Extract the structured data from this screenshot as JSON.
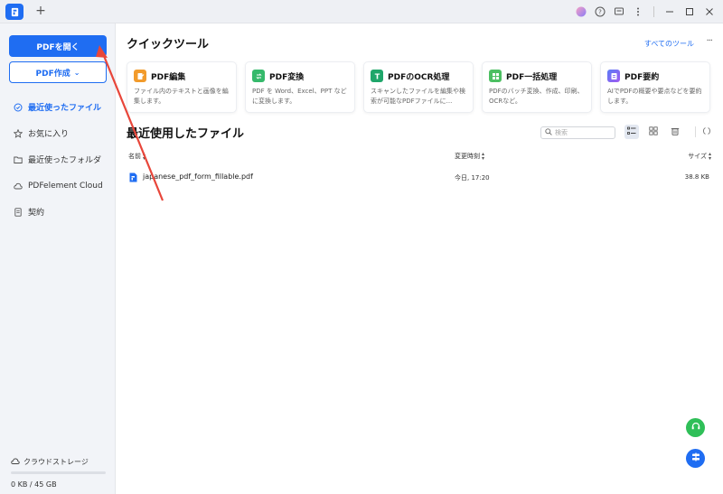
{
  "titlebar": {
    "icons": [
      "app-logo-icon",
      "plus-icon",
      "avatar-icon",
      "help-icon",
      "message-icon",
      "more-vertical-icon",
      "minimize-icon",
      "maximize-icon",
      "close-icon"
    ]
  },
  "sidebar": {
    "open_label": "PDFを開く",
    "create_label": "PDF作成",
    "items": [
      {
        "label": "最近使ったファイル",
        "icon": "clock-icon",
        "active": true
      },
      {
        "label": "お気に入り",
        "icon": "star-icon",
        "active": false
      },
      {
        "label": "最近使ったフォルダ",
        "icon": "folder-icon",
        "active": false
      },
      {
        "label": "PDFelement Cloud",
        "icon": "cloud-icon",
        "active": false
      },
      {
        "label": "契約",
        "icon": "document-icon",
        "active": false
      }
    ],
    "storage": {
      "label": "クラウドストレージ",
      "size": "0 KB / 45 GB",
      "fill_fraction": 0.0
    }
  },
  "quick_tools": {
    "title": "クイックツール",
    "all_link": "すべてのツール",
    "more": "···",
    "cards": [
      {
        "title": "PDF編集",
        "desc": "ファイル内のテキストと画像を編集します。",
        "icon": "edit-icon",
        "color": "#f29b2c"
      },
      {
        "title": "PDF変換",
        "desc": "PDF を Word、Excel、PPT などに変換します。",
        "icon": "convert-icon",
        "color": "#35b96b"
      },
      {
        "title": "PDFのOCR処理",
        "desc": "スキャンしたファイルを編集や検索が可能なPDFファイルに...",
        "icon": "ocr-icon",
        "color": "#1fa66a"
      },
      {
        "title": "PDF一括処理",
        "desc": "PDFのバッチ変換、作成、印刷、OCRなど。",
        "icon": "batch-icon",
        "color": "#4cbf62"
      },
      {
        "title": "PDF要約",
        "desc": "AIでPDFの概要や要点などを要約します。",
        "icon": "ai-summary-icon",
        "color": "#7a5af0"
      }
    ]
  },
  "recent": {
    "title": "最近使用したファイル",
    "search_placeholder": "検索",
    "columns": {
      "name": "名前",
      "modified": "変更時刻",
      "size": "サイズ"
    },
    "files": [
      {
        "name": "japanese_pdf_form_fillable.pdf",
        "modified": "今日, 17:20",
        "size": "38.8 KB"
      }
    ]
  },
  "colors": {
    "accent": "#1f6df2",
    "annotation_arrow": "#e8463a"
  }
}
